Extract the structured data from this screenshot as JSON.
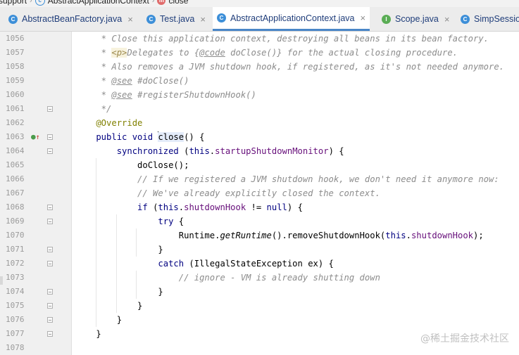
{
  "breadcrumb": {
    "items": [
      "support",
      "AbstractApplicationContext",
      "close"
    ],
    "icons": [
      "class-icon",
      "method-icon"
    ]
  },
  "tabs": [
    {
      "label": "AbstractBeanFactory.java",
      "close": "×",
      "icon": "C",
      "color": "#3d8fd8"
    },
    {
      "label": "Test.java",
      "close": "×",
      "icon": "C",
      "color": "#3d8fd8"
    },
    {
      "label": "AbstractApplicationContext.java",
      "close": "×",
      "icon": "C",
      "color": "#3d8fd8",
      "active": true
    },
    {
      "label": "Scope.java",
      "close": "×",
      "icon": "I",
      "color": "#5aad55"
    },
    {
      "label": "SimpSession",
      "close": "",
      "icon": "C",
      "color": "#3d8fd8"
    }
  ],
  "editor": {
    "line_numbers": [
      "1056",
      "1057",
      "1058",
      "1059",
      "1060",
      "1061",
      "1062",
      "1063",
      "1064",
      "1065",
      "1066",
      "1067",
      "1068",
      "1069",
      "1070",
      "1071",
      "1072",
      "1073",
      "1074",
      "1075",
      "1076",
      "1077",
      "1078"
    ],
    "text": {
      "l1056": "     * Close this application context, destroying all beans in its bean factory.",
      "l1057a": "     * ",
      "l1057b": "<p>",
      "l1057c": "Delegates to {",
      "l1057d": "@code",
      "l1057e": " doClose()} for the actual closing procedure.",
      "l1058": "     * Also removes a JVM shutdown hook, if registered, as it's not needed anymore.",
      "l1059a": "     * ",
      "l1059b": "@see",
      "l1059c": " #doClose()",
      "l1060a": "     * ",
      "l1060b": "@see",
      "l1060c": " #registerShutdownHook()",
      "l1061": "     */",
      "l1062": "    @Override",
      "l1063a": "    public void ",
      "l1063b": "close",
      "l1063c": "() {",
      "l1064a": "        synchronized",
      "l1064b": " (",
      "l1064c": "this",
      "l1064d": ".",
      "l1064e": "startupShutdownMonitor",
      "l1064f": ") {",
      "l1065": "            doClose();",
      "l1066": "            // If we registered a JVM shutdown hook, we don't need it anymore now:",
      "l1067": "            // We've already explicitly closed the context.",
      "l1068a": "            if",
      "l1068b": " (",
      "l1068c": "this",
      "l1068d": ".",
      "l1068e": "shutdownHook",
      "l1068f": " != ",
      "l1068g": "null",
      "l1068h": ") {",
      "l1069a": "                try",
      "l1069b": " {",
      "l1070a": "                    Runtime.",
      "l1070b": "getRuntime",
      "l1070c": "().removeShutdownHook(",
      "l1070d": "this",
      "l1070e": ".",
      "l1070f": "shutdownHook",
      "l1070g": ");",
      "l1071": "                }",
      "l1072a": "                catch",
      "l1072b": " (IllegalStateException ex) {",
      "l1073": "                    // ignore - VM is already shutting down",
      "l1074": "                }",
      "l1075": "            }",
      "l1076": "        }",
      "l1077": "    }",
      "l1078": ""
    }
  },
  "gutter_icons": {
    "override": "override-icon",
    "up": "↑"
  },
  "watermark": "@稀土掘金技术社区",
  "colors": {
    "keyword": "#000080",
    "comment": "#8c8c8c",
    "annotation": "#808000",
    "field": "#660e7a",
    "accent": "#4a86c8"
  }
}
